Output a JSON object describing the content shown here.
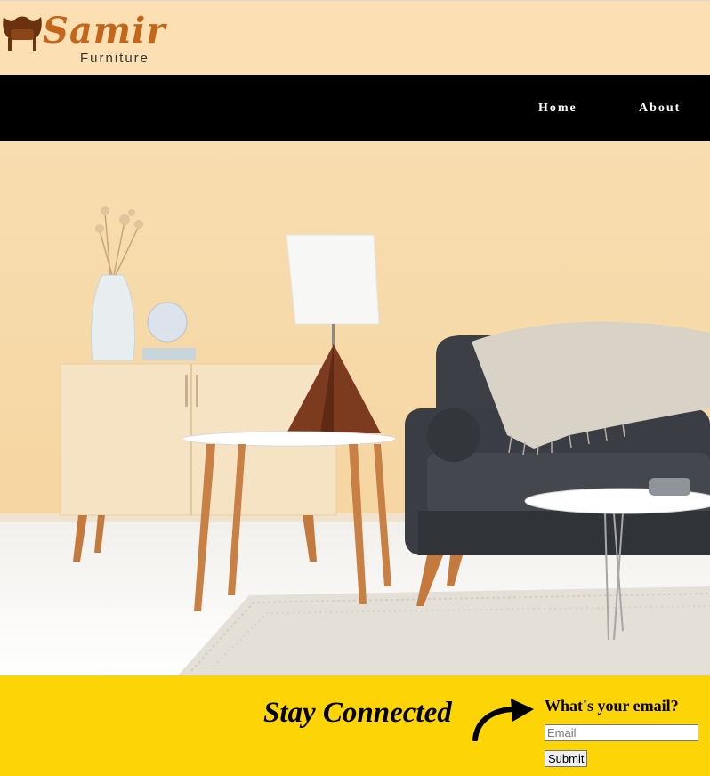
{
  "brand": {
    "name": "Samir",
    "subtitle": "Furniture"
  },
  "nav": {
    "items": [
      {
        "label": "Home"
      },
      {
        "label": "About"
      }
    ]
  },
  "newsletter": {
    "title": "Stay Connected",
    "question": "What's your email?",
    "email_placeholder": "Email",
    "submit_label": "Submit"
  },
  "colors": {
    "header_bg": "#fce0b3",
    "nav_bg": "#000000",
    "brand_orange": "#c4661a",
    "footer_bg": "#fdd506"
  },
  "icons": {
    "logo": "chair-icon",
    "arrow": "curved-arrow-icon"
  }
}
